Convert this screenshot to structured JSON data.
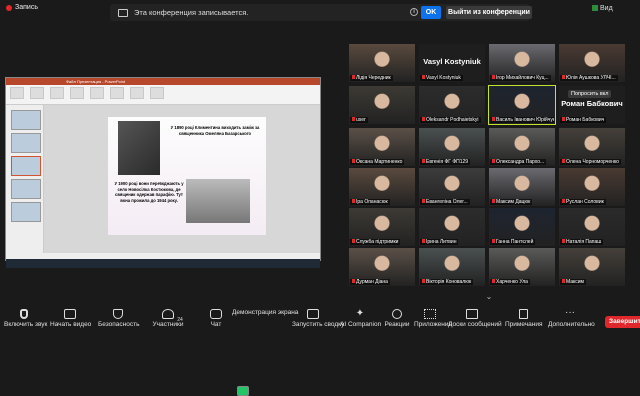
{
  "topbar": {
    "recording_label": "Запись",
    "notice_text": "Эта конференция записывается.",
    "ok_label": "OK",
    "leave_label": "Выйти из конференции",
    "view_label": "Вид"
  },
  "share": {
    "title": "Файл Презентация - PowerPoint",
    "slide_text_1": "У 1890 році Климентина виходить заміж за священника Омеляна Базарського",
    "slide_text_2": "У 1900 році вони переїжджають у село Новосілка Костюкова, де священик одержав парафію. Тут вона прожила до 1944 року."
  },
  "gallery": {
    "popout_label": "Попросить вкл",
    "tiles": [
      {
        "name": "Лідія Чередник",
        "kind": "video"
      },
      {
        "name": "Vasyl Kostyniuk",
        "kind": "name",
        "big": "Vasyl Kostyniuk"
      },
      {
        "name": "Ігор Михайлович Куц...",
        "kind": "video"
      },
      {
        "name": "Юлія Аушкова УЛЧЇ...",
        "kind": "video"
      },
      {
        "name": "user",
        "kind": "video"
      },
      {
        "name": "Oleksandr Podhaietskyi",
        "kind": "video"
      },
      {
        "name": "Василь Іванович Юрійчук",
        "kind": "video"
      },
      {
        "name": "Роман Бабкович",
        "kind": "name",
        "big": "Роман Бабкович"
      },
      {
        "name": "Оксана Мартиненко",
        "kind": "video"
      },
      {
        "name": "Евгенія ФГ ФП129",
        "kind": "video"
      },
      {
        "name": "Олександра Пархо...",
        "kind": "video"
      },
      {
        "name": "Олена Чорноморченко",
        "kind": "video"
      },
      {
        "name": "Іра Опанасюк",
        "kind": "video"
      },
      {
        "name": "Евангеліна Олег...",
        "kind": "video"
      },
      {
        "name": "Максим Дацюк",
        "kind": "video"
      },
      {
        "name": "Руслан Соловик",
        "kind": "video"
      },
      {
        "name": "Служба підтримки",
        "kind": "video"
      },
      {
        "name": "Ірина Литвин",
        "kind": "video"
      },
      {
        "name": "Ганна Пантєлей",
        "kind": "video"
      },
      {
        "name": "Наталія Папаш",
        "kind": "video"
      },
      {
        "name": "Дурман Діана",
        "kind": "video"
      },
      {
        "name": "Вікторія Коновалюк",
        "kind": "video"
      },
      {
        "name": "Харченко Ула",
        "kind": "video"
      },
      {
        "name": "Максим",
        "kind": "video"
      }
    ]
  },
  "toolbar": {
    "items": [
      {
        "label": "Включить звук",
        "icon": "microphone-icon"
      },
      {
        "label": "Начать видео",
        "icon": "camera-icon"
      },
      {
        "label": "Безопасность",
        "icon": "shield-icon"
      },
      {
        "label": "Участники",
        "icon": "participants-icon"
      },
      {
        "label": "Чат",
        "icon": "chat-icon"
      },
      {
        "label": "Демонстрация экрана",
        "icon": "share-screen-icon"
      },
      {
        "label": "Запустить сводку",
        "icon": "summary-icon"
      },
      {
        "label": "AI Companion",
        "icon": "ai-companion-icon"
      },
      {
        "label": "Реакции",
        "icon": "reactions-icon"
      },
      {
        "label": "Приложения",
        "icon": "apps-icon"
      },
      {
        "label": "Доски сообщений",
        "icon": "whiteboard-icon"
      },
      {
        "label": "Примечания",
        "icon": "notes-icon"
      },
      {
        "label": "Дополнительно",
        "icon": "more-icon"
      }
    ],
    "end_label": "Завершить",
    "participant_count": "24"
  }
}
